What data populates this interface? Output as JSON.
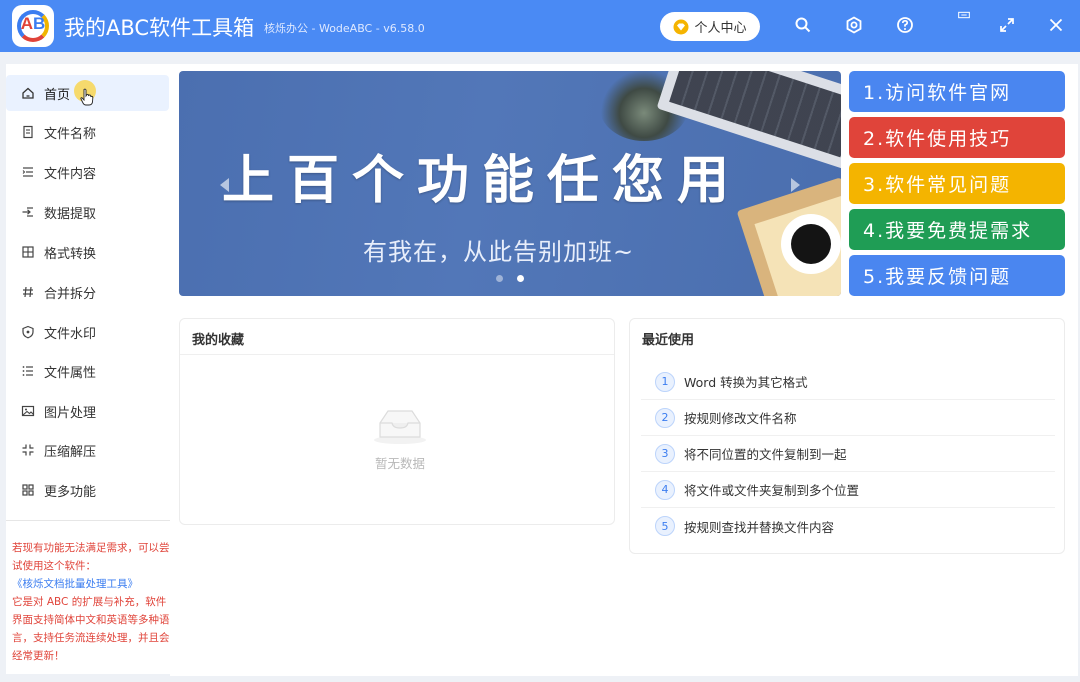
{
  "app": {
    "logo_text_a": "A",
    "logo_text_b": "B",
    "title": "我的ABC软件工具箱",
    "subtitle": "核烁办公 - WodeABC - v6.58.0",
    "user_center_label": "个人中心",
    "icons": [
      "search-icon",
      "gear-icon",
      "help-icon",
      "minimize-icon",
      "maximize-icon",
      "close-icon"
    ]
  },
  "sidebar": {
    "items": [
      {
        "label": "首页",
        "icon": "home-icon"
      },
      {
        "label": "文件名称",
        "icon": "file-icon"
      },
      {
        "label": "文件内容",
        "icon": "list-indent-icon"
      },
      {
        "label": "数据提取",
        "icon": "extract-icon"
      },
      {
        "label": "格式转换",
        "icon": "grid-icon"
      },
      {
        "label": "合并拆分",
        "icon": "hash-icon"
      },
      {
        "label": "文件水印",
        "icon": "shield-icon"
      },
      {
        "label": "文件属性",
        "icon": "list-icon"
      },
      {
        "label": "图片处理",
        "icon": "image-icon"
      },
      {
        "label": "压缩解压",
        "icon": "compress-icon"
      },
      {
        "label": "更多功能",
        "icon": "apps-icon"
      }
    ],
    "promo_line1": "若现有功能无法满足需求，可以尝试使用这个软件：",
    "promo_link": "《核烁文档批量处理工具》",
    "promo_line2": "它是对 ABC 的扩展与补充，软件界面支持简体中文和英语等多种语言，支持任务流连续处理，并且会经常更新！"
  },
  "banner": {
    "title": "上百个功能任您用",
    "subtitle": "有我在，从此告别加班~",
    "active_slide": 2,
    "slide_count": 2
  },
  "actions": [
    {
      "label": "1.访问软件官网",
      "color": "#4a86f0"
    },
    {
      "label": "2.软件使用技巧",
      "color": "#e0443a"
    },
    {
      "label": "3.软件常见问题",
      "color": "#f4b400"
    },
    {
      "label": "4.我要免费提需求",
      "color": "#1f9d55"
    },
    {
      "label": "5.我要反馈问题",
      "color": "#4a86f0"
    }
  ],
  "favorites": {
    "title": "我的收藏",
    "empty_text": "暂无数据"
  },
  "recent": {
    "title": "最近使用",
    "items": [
      {
        "num": "1",
        "label": "Word 转换为其它格式"
      },
      {
        "num": "2",
        "label": "按规则修改文件名称"
      },
      {
        "num": "3",
        "label": "将不同位置的文件复制到一起"
      },
      {
        "num": "4",
        "label": "将文件或文件夹复制到多个位置"
      },
      {
        "num": "5",
        "label": "按规则查找并替换文件内容"
      }
    ]
  }
}
